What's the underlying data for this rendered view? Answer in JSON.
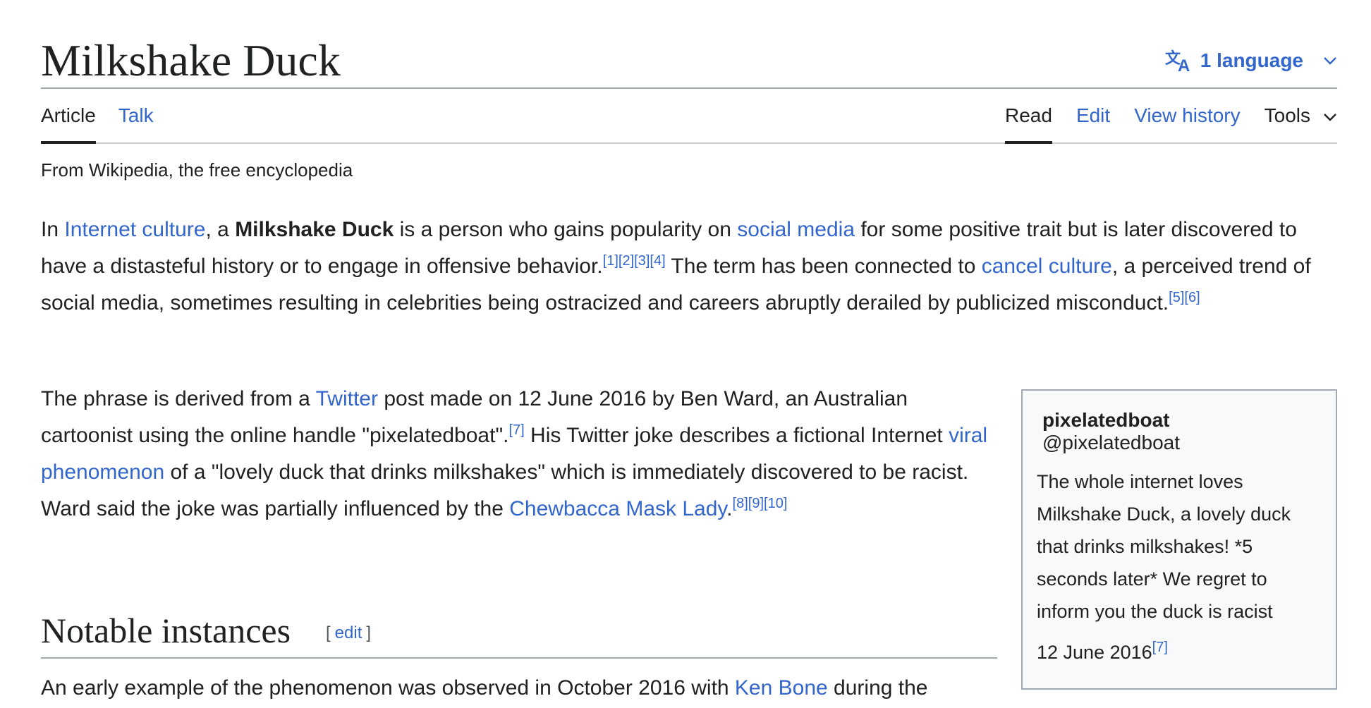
{
  "header": {
    "title": "Milkshake Duck",
    "language_label": "1 language"
  },
  "tabs": {
    "article": "Article",
    "talk": "Talk",
    "read": "Read",
    "edit": "Edit",
    "view_history": "View history",
    "tools": "Tools"
  },
  "tagline": "From Wikipedia, the free encyclopedia",
  "p1": {
    "t1": "In ",
    "link_internet_culture": "Internet culture",
    "t2": ", a ",
    "bold_term": "Milkshake Duck",
    "t3": " is a person who gains popularity on ",
    "link_social_media": "social media",
    "t4": " for some positive trait but is later discovered to have a distasteful history or to engage in offensive behavior.",
    "ref1": "[1]",
    "ref2": "[2]",
    "ref3": "[3]",
    "ref4": "[4]",
    "t5": " The term has been connected to ",
    "link_cancel_culture": "cancel culture",
    "t6": ", a perceived trend of social media, sometimes resulting in celebrities being ostracized and careers abruptly derailed by publicized misconduct.",
    "ref5": "[5]",
    "ref6": "[6]"
  },
  "p2": {
    "t1": "The phrase is derived from a ",
    "link_twitter": "Twitter",
    "t2": " post made on 12 June 2016 by Ben Ward, an Australian cartoonist using the online handle \"pixelatedboat\".",
    "ref7": "[7]",
    "t3": " His Twitter joke describes a fictional Internet ",
    "link_viral": "viral phenomenon",
    "t4": " of a \"lovely duck that drinks milkshakes\" which is immediately discovered to be racist. Ward said the joke was partially influenced by the ",
    "link_chewbacca": "Chewbacca Mask Lady",
    "t5": ".",
    "ref8": "[8]",
    "ref9": "[9]",
    "ref10": "[10]"
  },
  "section": {
    "title": "Notable instances",
    "bracket_open": "[",
    "edit_label": "edit",
    "bracket_close": "]"
  },
  "p3": {
    "t1": "An early example of the phenomenon was observed in October 2016 with ",
    "link_ken_bone": "Ken Bone",
    "t2": " during the"
  },
  "tweet": {
    "name": "pixelatedboat",
    "handle": "@pixelatedboat",
    "text": "The whole internet loves Milkshake Duck, a lovely duck that drinks milkshakes! *5 seconds later* We regret to inform you the duck is racist",
    "date": "12 June 2016",
    "ref": "[7]"
  }
}
